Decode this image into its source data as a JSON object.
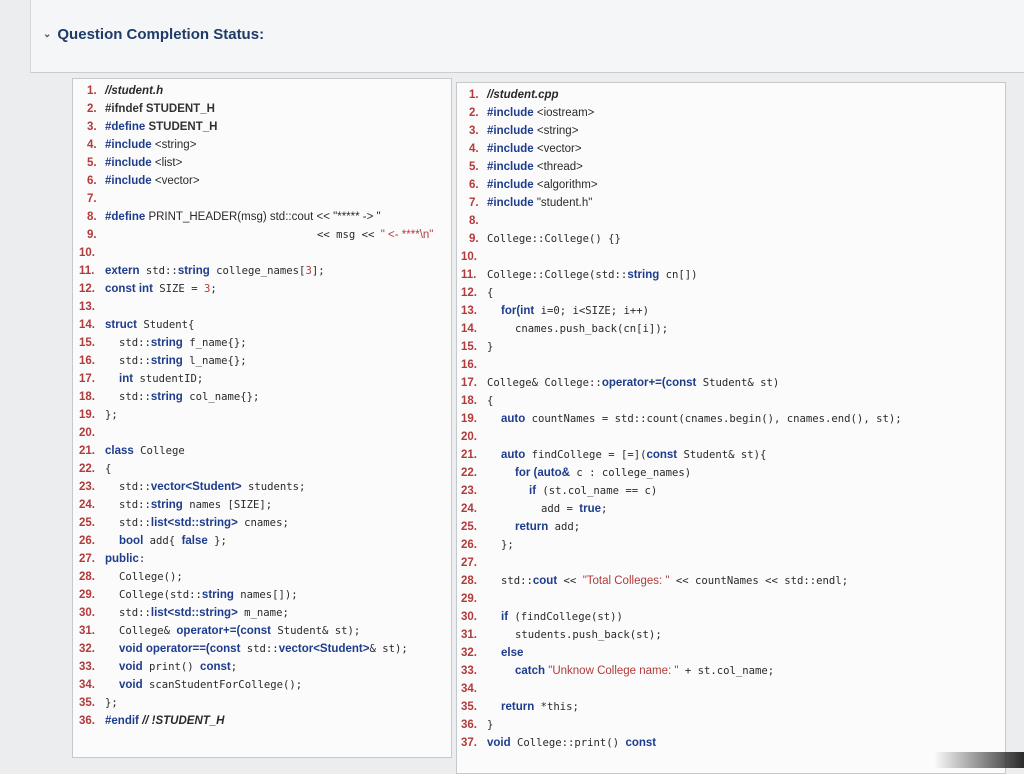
{
  "header": {
    "toggle_icon": "chevron-down-icon",
    "status_label": "Question Completion Status:"
  },
  "left_code": {
    "l1_n": "1.",
    "l1": "//student.h",
    "l2_n": "2.",
    "l2": "#ifndef STUDENT_H",
    "l3_n": "3.",
    "l3a": "#define",
    "l3b": " STUDENT_H",
    "l4_n": "4.",
    "l4a": "#include",
    "l4b": " <string>",
    "l5_n": "5.",
    "l5a": "#include",
    "l5b": " <list>",
    "l6_n": "6.",
    "l6a": "#include",
    "l6b": " <vector>",
    "l7_n": "7.",
    "l8_n": "8.",
    "l8a": "#define",
    "l8b": " PRINT_HEADER(msg) std::cout << \"***** -> \"",
    "l9_n": "9.",
    "l9a": "<< msg << ",
    "l9b": "\" <- ****\\n\"",
    "l10_n": "10.",
    "l11_n": "11.",
    "l11a": "extern",
    "l11b": " std::",
    "l11c": "string",
    "l11d": " college_names[",
    "l11e": "3",
    "l11f": "];",
    "l12_n": "12.",
    "l12a": "const int",
    "l12b": " SIZE = ",
    "l12c": "3",
    "l12d": ";",
    "l13_n": "13.",
    "l14_n": "14.",
    "l14a": "struct",
    "l14b": " Student{",
    "l15_n": "15.",
    "l15a": "std::",
    "l15b": "string",
    "l15c": " f_name{};",
    "l16_n": "16.",
    "l16a": "std::",
    "l16b": "string",
    "l16c": " l_name{};",
    "l17_n": "17.",
    "l17a": "int",
    "l17b": " studentID;",
    "l18_n": "18.",
    "l18a": "std::",
    "l18b": "string",
    "l18c": " col_name{};",
    "l19_n": "19.",
    "l19": "};",
    "l20_n": "20.",
    "l21_n": "21.",
    "l21a": "class",
    "l21b": " College",
    "l22_n": "22.",
    "l22": "{",
    "l23_n": "23.",
    "l23a": "std::",
    "l23b": "vector<Student>",
    "l23c": " students;",
    "l24_n": "24.",
    "l24a": "std::",
    "l24b": "string",
    "l24c": " names [SIZE];",
    "l25_n": "25.",
    "l25a": "std::",
    "l25b": "list<std::string>",
    "l25c": " cnames;",
    "l26_n": "26.",
    "l26a": "bool",
    "l26b": " add{ ",
    "l26c": "false",
    "l26d": " };",
    "l27_n": "27.",
    "l27a": "public",
    "l27b": ":",
    "l28_n": "28.",
    "l28": "College();",
    "l29_n": "29.",
    "l29a": "College(std::",
    "l29b": "string",
    "l29c": " names[]);",
    "l30_n": "30.",
    "l30a": "std::",
    "l30b": "list<std::string>",
    "l30c": " m_name;",
    "l31_n": "31.",
    "l31a": "College& ",
    "l31b": "operator+=(const",
    "l31c": " Student& st);",
    "l32_n": "32.",
    "l32a": "void operator==(const",
    "l32b": " std::",
    "l32c": "vector<Student>",
    "l32d": "& st);",
    "l33_n": "33.",
    "l33a": "void",
    "l33b": " print() ",
    "l33c": "const",
    "l33d": ";",
    "l34_n": "34.",
    "l34a": "void",
    "l34b": " scanStudentForCollege();",
    "l35_n": "35.",
    "l35": "};",
    "l36_n": "36.",
    "l36a": "#endif",
    "l36b": " // !STUDENT_H"
  },
  "right_code": {
    "r1_n": "1.",
    "r1": "//student.cpp",
    "r2_n": "2.",
    "r2a": "#include",
    "r2b": " <iostream>",
    "r3_n": "3.",
    "r3a": "#include",
    "r3b": " <string>",
    "r4_n": "4.",
    "r4a": "#include",
    "r4b": " <vector>",
    "r5_n": "5.",
    "r5a": "#include",
    "r5b": " <thread>",
    "r6_n": "6.",
    "r6a": "#include",
    "r6b": " <algorithm>",
    "r7_n": "7.",
    "r7a": "#include",
    "r7b": " \"student.h\"",
    "r8_n": "8.",
    "r9_n": "9.",
    "r9": "College::College() {}",
    "r10_n": "10.",
    "r11_n": "11.",
    "r11a": "College::College(std::",
    "r11b": "string",
    "r11c": " cn[])",
    "r12_n": "12.",
    "r12": "{",
    "r13_n": "13.",
    "r13a": "for(int",
    "r13b": " i=0; i<SIZE; i++)",
    "r14_n": "14.",
    "r14": "cnames.push_back(cn[i]);",
    "r15_n": "15.",
    "r15": "}",
    "r16_n": "16.",
    "r17_n": "17.",
    "r17a": "College& College::",
    "r17b": "operator+=(const",
    "r17c": " Student& st)",
    "r18_n": "18.",
    "r18": "{",
    "r19_n": "19.",
    "r19a": "auto",
    "r19b": " countNames = std::count(cnames.begin(), cnames.end(), st);",
    "r20_n": "20.",
    "r21_n": "21.",
    "r21a": "auto",
    "r21b": " findCollege = [=](",
    "r21c": "const",
    "r21d": " Student& st){",
    "r22_n": "22.",
    "r22a": "for (auto&",
    "r22b": " c : college_names)",
    "r23_n": "23.",
    "r23a": "if",
    "r23b": " (st.col_name == c)",
    "r24_n": "24.",
    "r24a": "add = ",
    "r24b": "true",
    "r24c": ";",
    "r25_n": "25.",
    "r25a": "return",
    "r25b": " add;",
    "r26_n": "26.",
    "r26": "};",
    "r27_n": "27.",
    "r28_n": "28.",
    "r28a": "std::",
    "r28b": "cout",
    "r28c": " << ",
    "r28d": "\"Total Colleges: \"",
    "r28e": " << countNames << std::endl;",
    "r29_n": "29.",
    "r30_n": "30.",
    "r30a": "if",
    "r30b": " (findCollege(st))",
    "r31_n": "31.",
    "r31": "students.push_back(st);",
    "r32_n": "32.",
    "r32": "else",
    "r33_n": "33.",
    "r33a": "catch",
    "r33b": " \"Unknow College name: \"",
    "r33c": " + st.col_name;",
    "r34_n": "34.",
    "r35_n": "35.",
    "r35a": "return",
    "r35b": " *this;",
    "r36_n": "36.",
    "r36": "}",
    "r37_n": "37.",
    "r37a": "void",
    "r37b": " College::print() ",
    "r37c": "const"
  }
}
